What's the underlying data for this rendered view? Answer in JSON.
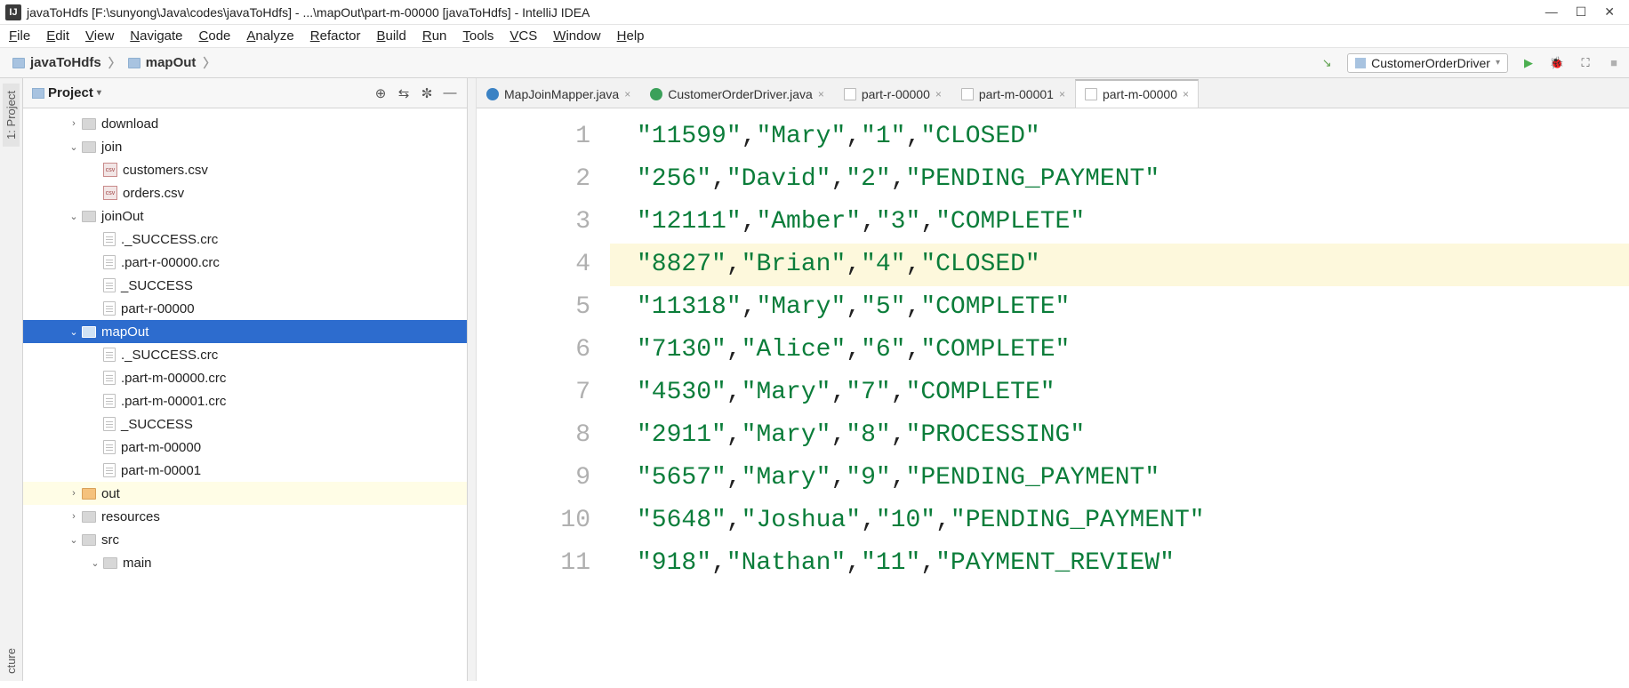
{
  "window": {
    "title": "javaToHdfs [F:\\sunyong\\Java\\codes\\javaToHdfs] - ...\\mapOut\\part-m-00000 [javaToHdfs] - IntelliJ IDEA"
  },
  "menubar": [
    "File",
    "Edit",
    "View",
    "Navigate",
    "Code",
    "Analyze",
    "Refactor",
    "Build",
    "Run",
    "Tools",
    "VCS",
    "Window",
    "Help"
  ],
  "breadcrumb": [
    "javaToHdfs",
    "mapOut"
  ],
  "runconfig": {
    "label": "CustomerOrderDriver"
  },
  "sidebar": {
    "tabs": [
      "1: Project",
      "cture"
    ]
  },
  "project": {
    "title": "Project",
    "tree": [
      {
        "indent": 1,
        "arrow": ">",
        "icon": "fldr",
        "label": "download"
      },
      {
        "indent": 1,
        "arrow": "v",
        "icon": "fldr",
        "label": "join"
      },
      {
        "indent": 2,
        "arrow": "",
        "icon": "csv",
        "label": "customers.csv"
      },
      {
        "indent": 2,
        "arrow": "",
        "icon": "csv",
        "label": "orders.csv"
      },
      {
        "indent": 1,
        "arrow": "v",
        "icon": "fldr",
        "label": "joinOut"
      },
      {
        "indent": 2,
        "arrow": "",
        "icon": "file",
        "label": "._SUCCESS.crc"
      },
      {
        "indent": 2,
        "arrow": "",
        "icon": "file",
        "label": ".part-r-00000.crc"
      },
      {
        "indent": 2,
        "arrow": "",
        "icon": "file",
        "label": "_SUCCESS"
      },
      {
        "indent": 2,
        "arrow": "",
        "icon": "file",
        "label": "part-r-00000"
      },
      {
        "indent": 1,
        "arrow": "v",
        "icon": "fldr-blue",
        "label": "mapOut",
        "selected": true
      },
      {
        "indent": 2,
        "arrow": "",
        "icon": "file",
        "label": "._SUCCESS.crc"
      },
      {
        "indent": 2,
        "arrow": "",
        "icon": "file",
        "label": ".part-m-00000.crc"
      },
      {
        "indent": 2,
        "arrow": "",
        "icon": "file",
        "label": ".part-m-00001.crc"
      },
      {
        "indent": 2,
        "arrow": "",
        "icon": "file",
        "label": "_SUCCESS"
      },
      {
        "indent": 2,
        "arrow": "",
        "icon": "file",
        "label": "part-m-00000"
      },
      {
        "indent": 2,
        "arrow": "",
        "icon": "file",
        "label": "part-m-00001"
      },
      {
        "indent": 1,
        "arrow": ">",
        "icon": "fldr-orange",
        "label": "out",
        "hover": true
      },
      {
        "indent": 1,
        "arrow": ">",
        "icon": "fldr",
        "label": "resources"
      },
      {
        "indent": 1,
        "arrow": "v",
        "icon": "fldr",
        "label": "src"
      },
      {
        "indent": 2,
        "arrow": "v",
        "icon": "fldr",
        "label": "main"
      }
    ]
  },
  "tabs": [
    {
      "icon": "c-blue",
      "label": "MapJoinMapper.java",
      "active": false
    },
    {
      "icon": "c-green",
      "label": "CustomerOrderDriver.java",
      "active": false
    },
    {
      "icon": "file",
      "label": "part-r-00000",
      "active": false
    },
    {
      "icon": "file",
      "label": "part-m-00001",
      "active": false
    },
    {
      "icon": "file",
      "label": "part-m-00000",
      "active": true
    }
  ],
  "editor": {
    "highlightLine": 4,
    "lines": [
      "\"11599\",\"Mary\",\"1\",\"CLOSED\"",
      "\"256\",\"David\",\"2\",\"PENDING_PAYMENT\"",
      "\"12111\",\"Amber\",\"3\",\"COMPLETE\"",
      "\"8827\",\"Brian\",\"4\",\"CLOSED\"",
      "\"11318\",\"Mary\",\"5\",\"COMPLETE\"",
      "\"7130\",\"Alice\",\"6\",\"COMPLETE\"",
      "\"4530\",\"Mary\",\"7\",\"COMPLETE\"",
      "\"2911\",\"Mary\",\"8\",\"PROCESSING\"",
      "\"5657\",\"Mary\",\"9\",\"PENDING_PAYMENT\"",
      "\"5648\",\"Joshua\",\"10\",\"PENDING_PAYMENT\"",
      "\"918\",\"Nathan\",\"11\",\"PAYMENT_REVIEW\""
    ]
  }
}
